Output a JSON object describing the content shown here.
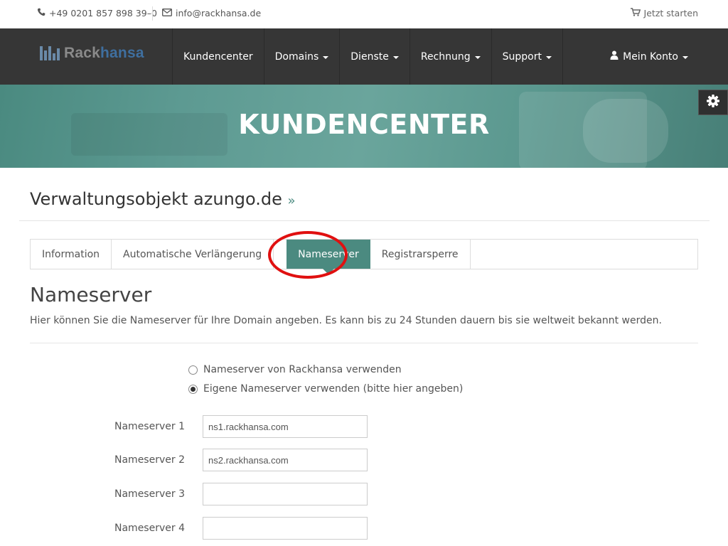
{
  "topbar": {
    "phone": "+49 0201 857 898 39–0",
    "email": "info@rackhansa.de",
    "start_label": "Jetzt starten"
  },
  "logo": {
    "part1": "Rack",
    "part2": "hansa"
  },
  "nav": {
    "items": [
      {
        "label": "Kundencenter",
        "dropdown": false
      },
      {
        "label": "Domains",
        "dropdown": true
      },
      {
        "label": "Dienste",
        "dropdown": true
      },
      {
        "label": "Rechnung",
        "dropdown": true
      },
      {
        "label": "Support",
        "dropdown": true
      }
    ],
    "account_label": "Mein Konto"
  },
  "hero": {
    "title": "KUNDENCENTER"
  },
  "object": {
    "title": "Verwaltungsobjekt azungo.de",
    "suffix": "»"
  },
  "tabs": [
    {
      "label": "Information",
      "active": false
    },
    {
      "label": "Automatische Verlängerung",
      "active": false
    },
    {
      "label": "Nameserver",
      "active": true
    },
    {
      "label": "Registrarsperre",
      "active": false
    }
  ],
  "section": {
    "title": "Nameserver",
    "description": "Hier können Sie die Nameserver für Ihre Domain angeben. Es kann bis zu 24 Stunden dauern bis sie weltweit bekannt werden."
  },
  "radios": [
    {
      "label": "Nameserver von Rackhansa verwenden",
      "checked": false
    },
    {
      "label": "Eigene Nameserver verwenden (bitte hier angeben)",
      "checked": true
    }
  ],
  "fields": [
    {
      "label": "Nameserver 1",
      "value": "ns1.rackhansa.com"
    },
    {
      "label": "Nameserver 2",
      "value": "ns2.rackhansa.com"
    },
    {
      "label": "Nameserver 3",
      "value": ""
    },
    {
      "label": "Nameserver 4",
      "value": ""
    }
  ],
  "colors": {
    "accent": "#4b8a80",
    "navbar": "#363636",
    "annotation": "#e01010"
  }
}
